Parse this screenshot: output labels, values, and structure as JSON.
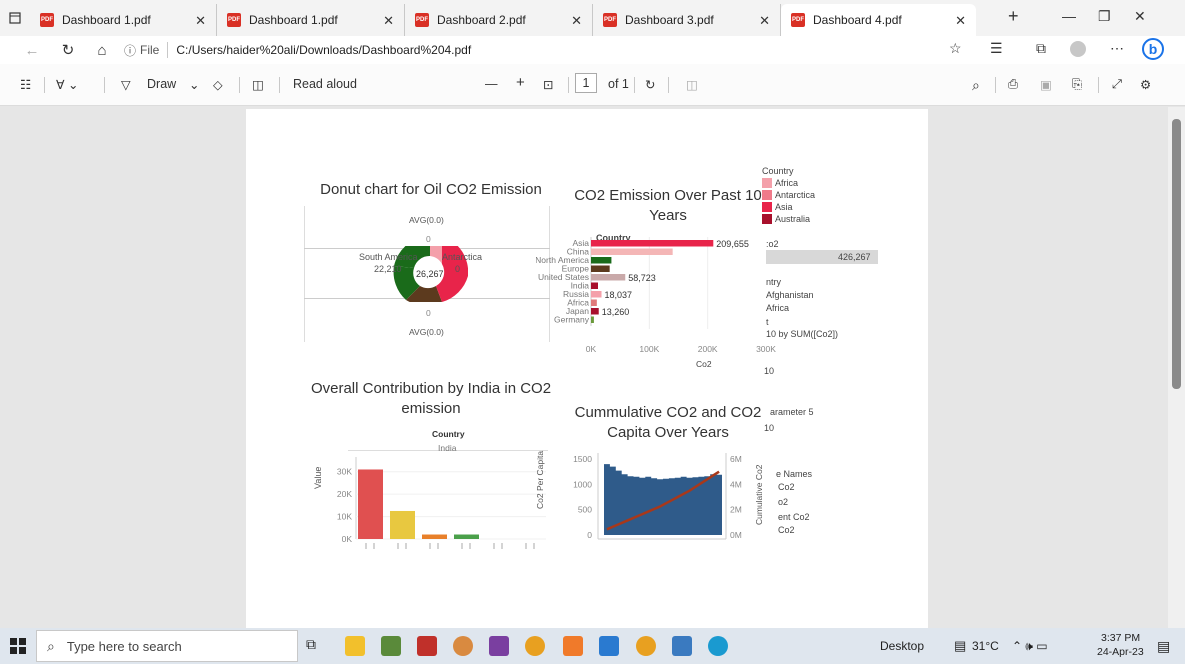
{
  "tabs": [
    {
      "label": "Dashboard 1.pdf",
      "active": false
    },
    {
      "label": "Dashboard 1.pdf",
      "active": false
    },
    {
      "label": "Dashboard 2.pdf",
      "active": false
    },
    {
      "label": "Dashboard 3.pdf",
      "active": false
    },
    {
      "label": "Dashboard 4.pdf",
      "active": true
    }
  ],
  "address": {
    "file_label": "File",
    "url": "C:/Users/haider%20ali/Downloads/Dashboard%204.pdf"
  },
  "toolbar": {
    "draw": "Draw",
    "read_aloud": "Read aloud",
    "page_number": "1",
    "page_total": "of 1"
  },
  "donut": {
    "title": "Donut chart for Oil  CO2 Emission",
    "avg_top": "AVG(0.0)",
    "avg_bottom": "AVG(0.0)",
    "zero_top": "0",
    "zero_bottom": "0",
    "label_sa": "South America",
    "value_sa": "22,210",
    "label_ant": "Antarctica",
    "value_ant": "0",
    "center": "26,267"
  },
  "bar10": {
    "title": "CO2 Emission Over Past 10 Years",
    "legend_header": "Country",
    "xlabel": "Co2",
    "ylabel": "Country"
  },
  "legend": {
    "title": "Country",
    "items": [
      {
        "label": "Africa",
        "color": "#f4a0aa"
      },
      {
        "label": "Antarctica",
        "color": "#f07a8a"
      },
      {
        "label": "Asia",
        "color": "#e8244a"
      },
      {
        "label": "Australia",
        "color": "#a8102c"
      }
    ],
    "co2_label": ":o2",
    "co2_value": "426,267",
    "try_label": "ntry",
    "afghanistan": "Afghanistan",
    "africa2": "Africa",
    "t": "t",
    "top_caption": "10 by SUM([Co2])",
    "ten1": "10",
    "param": "arameter 5",
    "ten2": "10",
    "measure_names": "e Names",
    "m1": "Co2",
    "m2": "o2",
    "m3": "ent Co2",
    "m4": "Co2"
  },
  "india": {
    "title": "Overall Contribution by India in CO2 emission",
    "country_header": "Country",
    "country": "India",
    "ylabel": "Value",
    "ticks": [
      "30K",
      "20K",
      "10K",
      "0K"
    ]
  },
  "cumul": {
    "title": "Cummulative CO2 and CO2 Capita Over Years",
    "ylabel_left": "Co2 Per Capita",
    "ylabel_right": "Cumulative Co2",
    "left_ticks": [
      "1500",
      "1000",
      "500",
      "0"
    ],
    "right_ticks": [
      "6M",
      "4M",
      "2M",
      "0M"
    ]
  },
  "chart_data": [
    {
      "type": "bar",
      "title": "CO2 Emission Over Past 10 Years",
      "categories": [
        "Asia",
        "China",
        "North America",
        "Europe",
        "United States",
        "India",
        "Russia",
        "Africa",
        "Japan",
        "Germany"
      ],
      "values": [
        209655,
        140000,
        35000,
        32000,
        58723,
        12000,
        18037,
        10000,
        13260,
        5000
      ],
      "labels": [
        "209,655",
        "",
        "",
        "",
        "58,723",
        "",
        "18,037",
        "",
        "13,260",
        ""
      ],
      "colors": [
        "#e8244a",
        "#f4b6b6",
        "#1a6b1a",
        "#5c3a1e",
        "#c9a9a9",
        "#a8102c",
        "#f4a0aa",
        "#e07a7a",
        "#a8102c",
        "#6a9a3a"
      ],
      "xticks": [
        "0K",
        "100K",
        "200K",
        "300K"
      ],
      "xlim": [
        0,
        300000
      ],
      "xlabel": "Co2",
      "ylabel": "Country"
    },
    {
      "type": "bar",
      "title": "Overall Contribution by India in CO2 emission",
      "categories": [
        "",
        "",
        "",
        "",
        "",
        ""
      ],
      "values": [
        31000,
        12500,
        2000,
        2000,
        0,
        0
      ],
      "colors": [
        "#e05050",
        "#e8c840",
        "#e8802a",
        "#4aa04a",
        "#aaa",
        "#aaa"
      ],
      "yticks": [
        "30K",
        "20K",
        "10K",
        "0K"
      ],
      "ylim": [
        0,
        33000
      ],
      "ylabel": "Value"
    },
    {
      "type": "bar",
      "title": "Cummulative CO2 and CO2 Capita Over Years",
      "series": [
        {
          "name": "Co2 Per Capita",
          "values": [
            1400,
            1350,
            1270,
            1200,
            1160,
            1150,
            1130,
            1150,
            1120,
            1100,
            1110,
            1120,
            1130,
            1150,
            1130,
            1140,
            1150,
            1160,
            1200,
            1190
          ]
        },
        {
          "name": "Cumulative Co2",
          "values": [
            0.45,
            0.65,
            0.85,
            1.05,
            1.25,
            1.45,
            1.65,
            1.85,
            2.05,
            2.25,
            2.5,
            2.75,
            3.0,
            3.25,
            3.5,
            3.8,
            4.1,
            4.4,
            4.7,
            5.0
          ]
        }
      ],
      "ylim_left": [
        0,
        1500
      ],
      "ylim_right": [
        0,
        6
      ],
      "ylabel": "Co2 Per Capita",
      "y2label": "Cumulative Co2"
    }
  ],
  "taskbar": {
    "search": "Type here to search",
    "desktop": "Desktop",
    "weather": "31°C",
    "time": "3:37 PM",
    "date": "24-Apr-23"
  }
}
